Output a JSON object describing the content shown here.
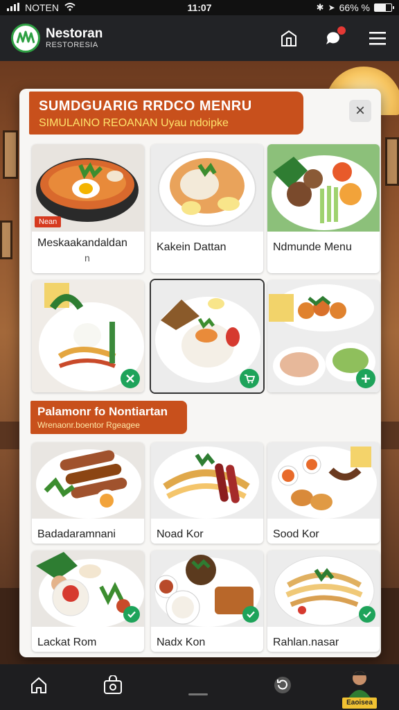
{
  "status_bar": {
    "carrier": "NOTEN",
    "time": "11:07",
    "battery": "66% %"
  },
  "header": {
    "brand_name": "Nestoran",
    "brand_sub": "RESTORESIA"
  },
  "menu_card": {
    "title": "SUMDGUARIG RRDCO MENRU",
    "subtitle": "SIMULAINO REOANAN Uyau ndoipke",
    "close_label": "×",
    "top_items": [
      {
        "label": "Meskaakandaldan",
        "sub": "n",
        "badge": "Nean"
      },
      {
        "label": "Kakein Dattan"
      },
      {
        "label": "Ndmunde Menu"
      },
      {
        "label": ""
      },
      {
        "label": ""
      },
      {
        "label": ""
      }
    ],
    "section": {
      "title": "Palamonr fo Nontiartan",
      "subtitle": "Wrenaonr.boentor Rgeagee"
    },
    "bottom_items": [
      {
        "label": "Badadaramnani"
      },
      {
        "label": "Noad Kor"
      },
      {
        "label": "Sood Kor"
      },
      {
        "label": "Lackat Rom"
      },
      {
        "label": "Nadx Kon"
      },
      {
        "label": "Rahlan.nasar"
      }
    ]
  },
  "profile": {
    "tag": "Eaoisea"
  },
  "colors": {
    "accent": "#c8501c",
    "brand_green": "#2ea043",
    "action_green": "#1ea35a",
    "badge_red": "#d63a1f"
  }
}
